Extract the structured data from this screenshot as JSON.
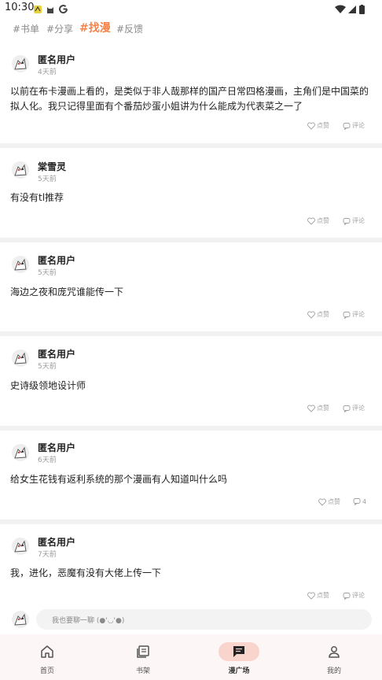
{
  "status": {
    "time": "10:30"
  },
  "tabs": [
    "#书单",
    "#分享",
    "#找漫",
    "#反馈"
  ],
  "actions": {
    "like": "点赞",
    "comment": "评论"
  },
  "posts": [
    {
      "user": "匿名用户",
      "time": "4天前",
      "content": "以前在布卡漫画上看的，是类似于非人哉那样的国产日常四格漫画，主角们是中国菜的拟人化。我只记得里面有个番茄炒蛋小姐讲为什么能成为代表菜之一了",
      "comment": "评论"
    },
    {
      "user": "棠雪灵",
      "time": "5天前",
      "content": "有没有tl推荐",
      "comment": "评论"
    },
    {
      "user": "匿名用户",
      "time": "5天前",
      "content": "海边之夜和庞咒谁能传一下",
      "comment": "评论"
    },
    {
      "user": "匿名用户",
      "time": "5天前",
      "content": "史诗级领地设计师",
      "comment": "评论"
    },
    {
      "user": "匿名用户",
      "time": "6天前",
      "content": "给女生花钱有返利系统的那个漫画有人知道叫什么吗",
      "comment": "4"
    },
    {
      "user": "匿名用户",
      "time": "7天前",
      "content": "我，进化，恶魔有没有大佬上传一下",
      "comment": "评论"
    }
  ],
  "input": {
    "placeholder": "我也要聊一聊 (●'◡'●)"
  },
  "nav": [
    "首页",
    "书架",
    "漫广场",
    "我的"
  ],
  "colors": {
    "accent": "#f6834b",
    "nav_pill": "#f9d4cc"
  }
}
